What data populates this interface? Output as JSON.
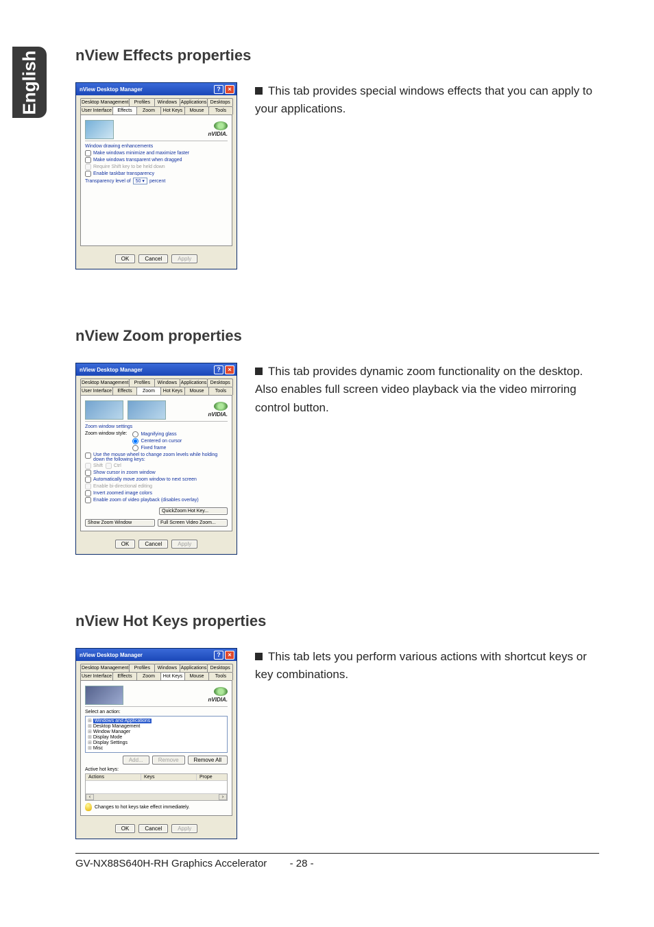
{
  "side_label": "English",
  "sections": {
    "effects": {
      "heading": "nView Effects properties",
      "desc": "This tab provides special windows effects that you can apply to your applications.",
      "dialog": {
        "title": "nView Desktop Manager",
        "tabs_row1": [
          "Desktop Management",
          "Profiles",
          "Windows",
          "Applications",
          "Desktops"
        ],
        "tabs_row2": [
          "User Interface",
          "Effects",
          "Zoom",
          "Hot Keys",
          "Mouse",
          "Tools"
        ],
        "active_tab": "Effects",
        "brand": "nVIDIA.",
        "group_label": "Window drawing enhancements",
        "chk1": "Make windows minimize and maximize faster",
        "chk2": "Make windows transparent when dragged",
        "chk3": "Require Shift key to be held down",
        "chk4": "Enable taskbar transparency",
        "trans_label_pre": "Transparency level of",
        "trans_value": "50",
        "trans_label_post": "percent",
        "ok": "OK",
        "cancel": "Cancel",
        "apply": "Apply"
      }
    },
    "zoom": {
      "heading": "nView Zoom properties",
      "desc": "This tab provides dynamic zoom functionality on the desktop. Also enables full screen video playback via the video mirroring control button.",
      "dialog": {
        "title": "nView Desktop Manager",
        "tabs_row1": [
          "Desktop Management",
          "Profiles",
          "Windows",
          "Applications",
          "Desktops"
        ],
        "tabs_row2": [
          "User Interface",
          "Effects",
          "Zoom",
          "Hot Keys",
          "Mouse",
          "Tools"
        ],
        "active_tab": "Zoom",
        "brand": "nVIDIA.",
        "group_label": "Zoom window settings",
        "style_label": "Zoom window style:",
        "r1": "Magnifying glass",
        "r2": "Centered on cursor",
        "r3": "Fixed frame",
        "wheel": "Use the mouse wheel to change zoom levels while holding down the following keys:",
        "shift": "Shift",
        "ctrl": "Ctrl",
        "c1": "Show cursor in zoom window",
        "c2": "Automatically move zoom window to next screen",
        "c3": "Enable bi-directional editing",
        "c4": "Invert zoomed image colors",
        "c5": "Enable zoom of video playback (disables overlay)",
        "btn_quick": "QuickZoom Hot Key...",
        "btn_show": "Show Zoom Window",
        "btn_full": "Full Screen Video Zoom...",
        "ok": "OK",
        "cancel": "Cancel",
        "apply": "Apply"
      }
    },
    "hotkeys": {
      "heading": "nView Hot Keys properties",
      "desc": "This tab lets you perform various actions with shortcut keys or key combinations.",
      "dialog": {
        "title": "nView Desktop Manager",
        "tabs_row1": [
          "Desktop Management",
          "Profiles",
          "Windows",
          "Applications",
          "Desktops"
        ],
        "tabs_row2": [
          "User Interface",
          "Effects",
          "Zoom",
          "Hot Keys",
          "Mouse",
          "Tools"
        ],
        "active_tab": "Hot Keys",
        "brand": "nVIDIA.",
        "select_label": "Select an action:",
        "tree": [
          "Windows and Applications",
          "Desktop Management",
          "Window Manager",
          "Display Mode",
          "Display Settings",
          "Misc"
        ],
        "btn_add": "Add...",
        "btn_remove": "Remove",
        "btn_remove_all": "Remove All",
        "active_label": "Active hot keys:",
        "col_actions": "Actions",
        "col_keys": "Keys",
        "col_props": "Prope",
        "tip": "Changes to hot keys take effect immediately.",
        "ok": "OK",
        "cancel": "Cancel",
        "apply": "Apply"
      }
    }
  },
  "footer": {
    "left": "GV-NX88S640H-RH Graphics Accelerator",
    "page": "- 28 -"
  }
}
